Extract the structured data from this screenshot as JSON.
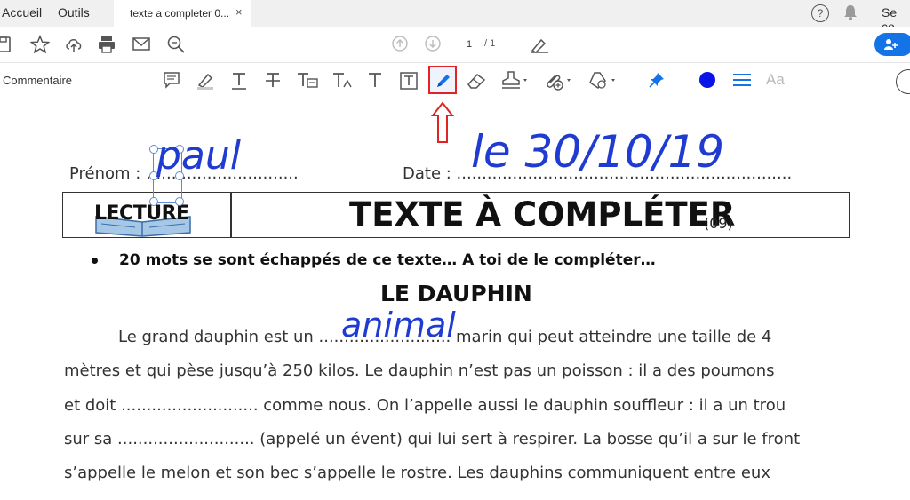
{
  "tabbar": {
    "home": "Accueil",
    "tools": "Outils",
    "doc_tab": "texte a completer 0...",
    "close": "×",
    "help": "?",
    "signin": "Se co"
  },
  "toolbar": {
    "page_current": "1",
    "page_total": "/ 1"
  },
  "comment_bar": {
    "label": "Commentaire",
    "font_label": "Aa",
    "color": "#0a14e8"
  },
  "document": {
    "prenom_label": "Prénom : ..............................",
    "date_label": "Date : ..................................................................",
    "handwritten_name": "paul",
    "handwritten_date": "le 30/10/19",
    "lecture": "LECTURE",
    "title": "TEXTE À COMPLÉTER",
    "title_num": "(09)",
    "bullet": "20 mots se sont échappés de ce texte… A toi de le compléter…",
    "subtitle": "LE DAUPHIN",
    "handwritten_word": "animal",
    "lines": [
      "Le grand dauphin est un .......................... marin qui peut atteindre une taille de 4",
      "mètres et qui pèse jusqu’à 250 kilos. Le dauphin n’est pas un poisson : il a des poumons",
      "et doit ........................... comme nous. On l’appelle aussi le dauphin souffleur : il a un trou",
      "sur sa ........................... (appelé un évent) qui lui sert à respirer. La bosse qu’il a sur le front",
      "s’appelle le melon et son bec s’appelle le rostre. Les dauphins communiquent entre eux"
    ]
  }
}
